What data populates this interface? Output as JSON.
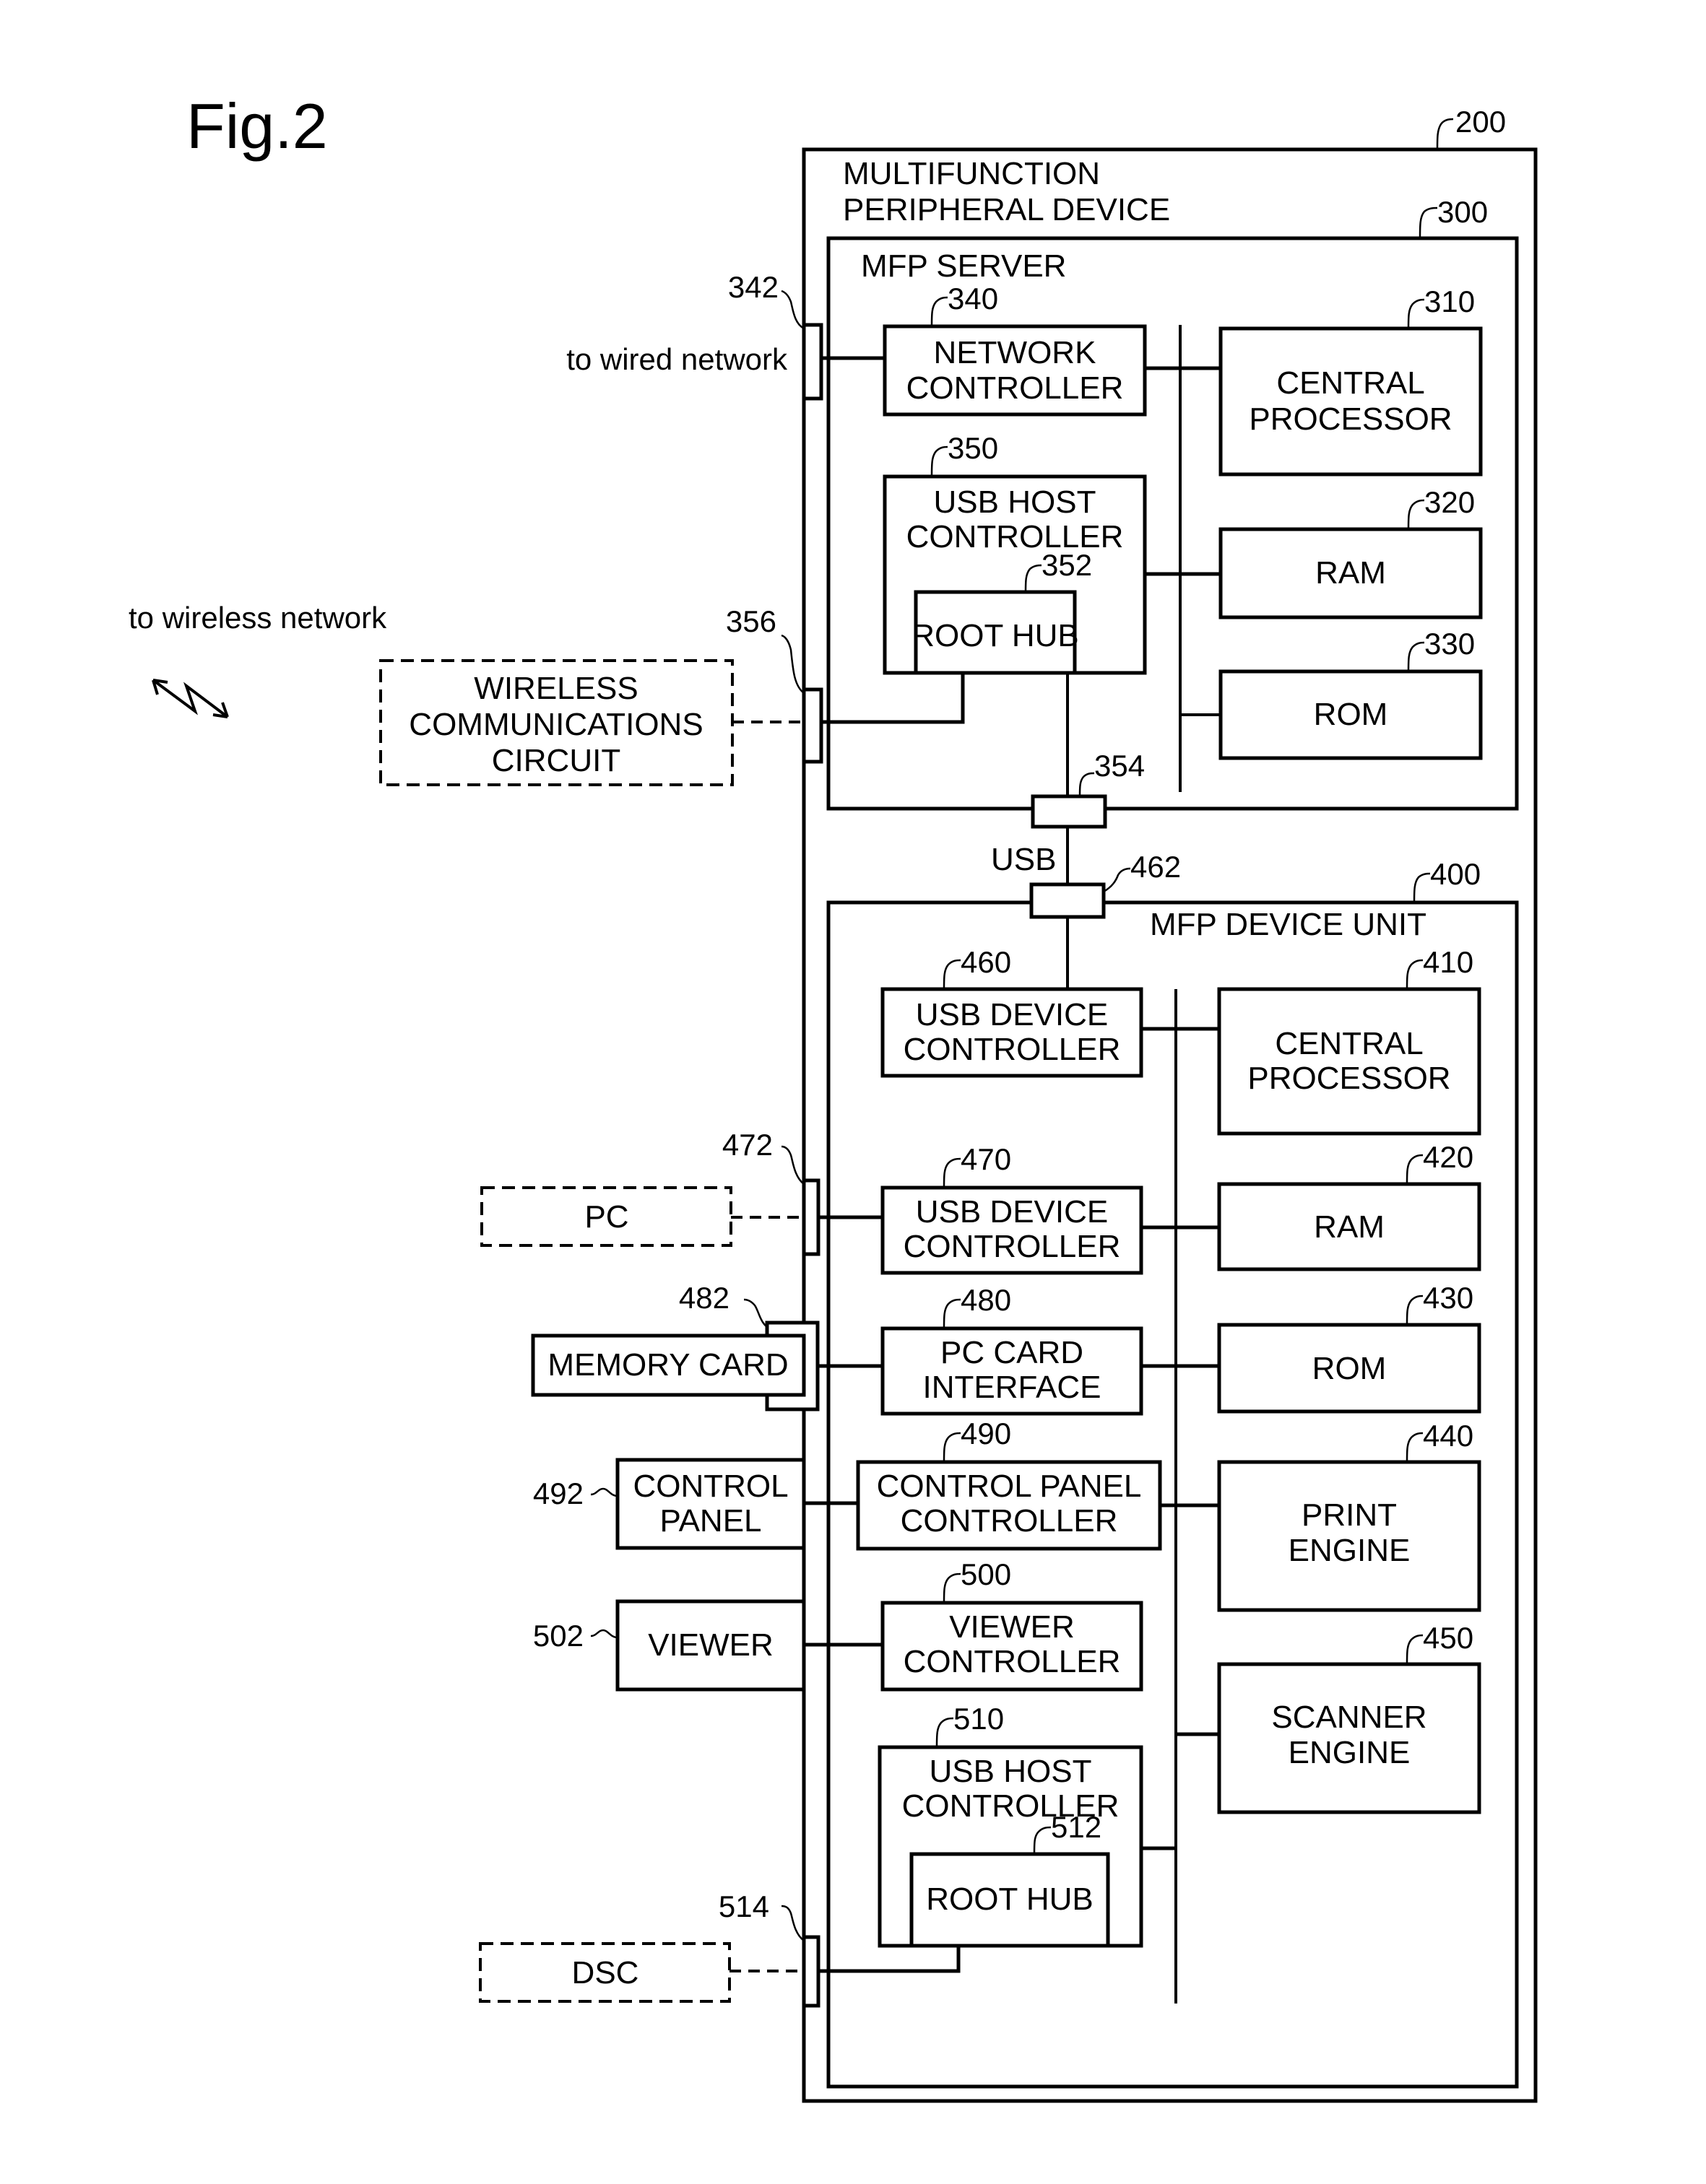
{
  "figure": {
    "title": "Fig.2"
  },
  "device": {
    "ref": "200",
    "title_line1": "MULTIFUNCTION",
    "title_line2": "PERIPHERAL DEVICE"
  },
  "server": {
    "ref": "300",
    "title": "MFP SERVER",
    "network_controller": {
      "ref": "340",
      "line1": "NETWORK",
      "line2": "CONTROLLER"
    },
    "central_processor": {
      "ref": "310",
      "line1": "CENTRAL",
      "line2": "PROCESSOR"
    },
    "usb_host_controller": {
      "ref": "350",
      "line1": "USB HOST",
      "line2": "CONTROLLER"
    },
    "root_hub": {
      "ref": "352",
      "label": "ROOT HUB"
    },
    "ram": {
      "ref": "320",
      "label": "RAM"
    },
    "rom": {
      "ref": "330",
      "label": "ROM"
    },
    "wired_port": {
      "ref": "342"
    },
    "wireless_port": {
      "ref": "356"
    },
    "usb_port": {
      "ref": "354"
    }
  },
  "external_network": {
    "wired_label": "to wired network",
    "wireless_label": "to wireless network",
    "wireless_circuit": {
      "line1": "WIRELESS",
      "line2": "COMMUNICATIONS",
      "line3": "CIRCUIT"
    }
  },
  "usb_link_label": "USB",
  "device_unit": {
    "ref": "400",
    "title": "MFP DEVICE UNIT",
    "usb_port": {
      "ref": "462"
    },
    "usb_device_controller_1": {
      "ref": "460",
      "line1": "USB DEVICE",
      "line2": "CONTROLLER"
    },
    "central_processor": {
      "ref": "410",
      "line1": "CENTRAL",
      "line2": "PROCESSOR"
    },
    "usb_device_controller_2": {
      "ref": "470",
      "line1": "USB DEVICE",
      "line2": "CONTROLLER"
    },
    "ram": {
      "ref": "420",
      "label": "RAM"
    },
    "pc_card_interface": {
      "ref": "480",
      "line1": "PC CARD",
      "line2": "INTERFACE"
    },
    "rom": {
      "ref": "430",
      "label": "ROM"
    },
    "control_panel_controller": {
      "ref": "490",
      "line1": "CONTROL PANEL",
      "line2": "CONTROLLER"
    },
    "print_engine": {
      "ref": "440",
      "line1": "PRINT",
      "line2": "ENGINE"
    },
    "viewer_controller": {
      "ref": "500",
      "line1": "VIEWER",
      "line2": "CONTROLLER"
    },
    "scanner_engine": {
      "ref": "450",
      "line1": "SCANNER",
      "line2": "ENGINE"
    },
    "usb_host_controller": {
      "ref": "510",
      "line1": "USB HOST",
      "line2": "CONTROLLER"
    },
    "root_hub": {
      "ref": "512",
      "label": "ROOT HUB"
    },
    "pc_port": {
      "ref": "472"
    },
    "card_slot": {
      "ref": "482"
    },
    "dsc_port": {
      "ref": "514"
    }
  },
  "externals": {
    "pc": {
      "label": "PC"
    },
    "memory_card": {
      "label": "MEMORY CARD"
    },
    "control_panel": {
      "ref": "492",
      "line1": "CONTROL",
      "line2": "PANEL"
    },
    "viewer": {
      "ref": "502",
      "label": "VIEWER"
    },
    "dsc": {
      "label": "DSC"
    }
  }
}
